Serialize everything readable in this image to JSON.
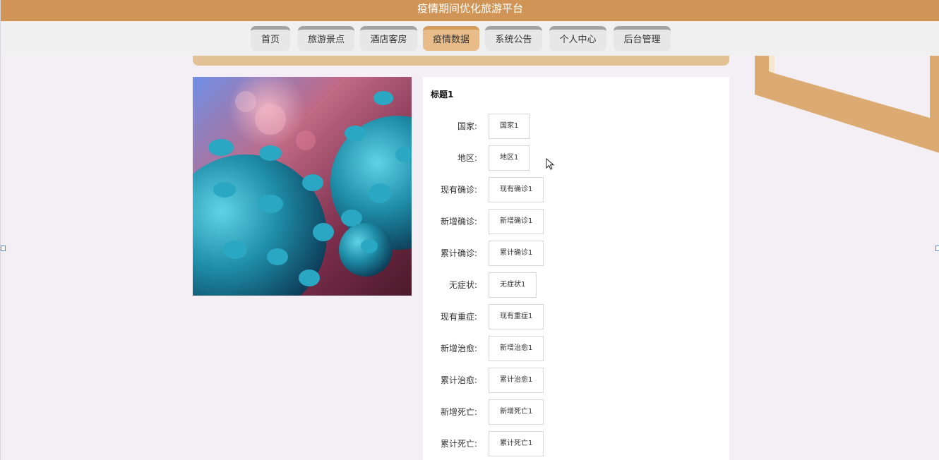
{
  "app_title": "疫情期间优化旅游平台",
  "nav": {
    "items": [
      {
        "label": "首页",
        "active": false
      },
      {
        "label": "旅游景点",
        "active": false
      },
      {
        "label": "酒店客房",
        "active": false
      },
      {
        "label": "疫情数据",
        "active": true
      },
      {
        "label": "系统公告",
        "active": false
      },
      {
        "label": "个人中心",
        "active": false
      },
      {
        "label": "后台管理",
        "active": false
      }
    ]
  },
  "detail": {
    "title": "标题1",
    "image_icon": "coronavirus-image",
    "fields": [
      {
        "label": "国家:",
        "value": "国家1"
      },
      {
        "label": "地区:",
        "value": "地区1"
      },
      {
        "label": "现有确诊:",
        "value": "现有确诊1"
      },
      {
        "label": "新增确诊:",
        "value": "新增确诊1"
      },
      {
        "label": "累计确诊:",
        "value": "累计确诊1"
      },
      {
        "label": "无症状:",
        "value": "无症状1"
      },
      {
        "label": "现有重症:",
        "value": "现有重症1"
      },
      {
        "label": "新增治愈:",
        "value": "新增治愈1"
      },
      {
        "label": "累计治愈:",
        "value": "累计治愈1"
      },
      {
        "label": "新增死亡:",
        "value": "新增死亡1"
      },
      {
        "label": "累计死亡:",
        "value": "累计死亡1"
      }
    ]
  },
  "colors": {
    "title_bar": "#d09556",
    "nav_active": "#e8bc88",
    "accent_strip": "#e2c295",
    "page_bg": "#f4eff4"
  }
}
